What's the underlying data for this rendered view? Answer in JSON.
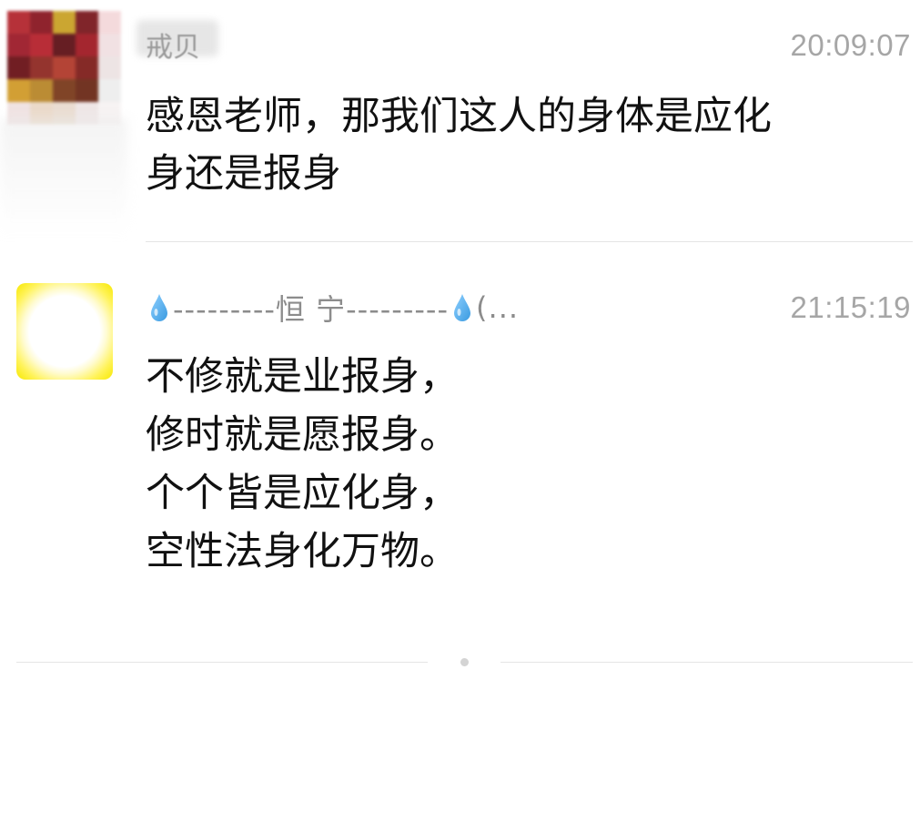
{
  "messages": [
    {
      "sender": "戒贝",
      "time": "20:09:07",
      "lines": [
        "感恩老师，那我们这人的身体是应化",
        "身还是报身"
      ]
    },
    {
      "sender": "---------恒 宁---------",
      "sender_suffix": "(...",
      "time": "21:15:19",
      "lines": [
        "不修就是业报身，",
        "修时就是愿报身。",
        "个个皆是应化身，",
        "空性法身化万物。"
      ]
    }
  ],
  "colors": {
    "text": "#111111",
    "meta": "#a6a6a6",
    "divider": "#e5e5e5",
    "drop": "#3a9ae0"
  },
  "icons": {
    "sender_prefix": "water-drop-icon",
    "sender_suffix": "water-drop-icon"
  }
}
